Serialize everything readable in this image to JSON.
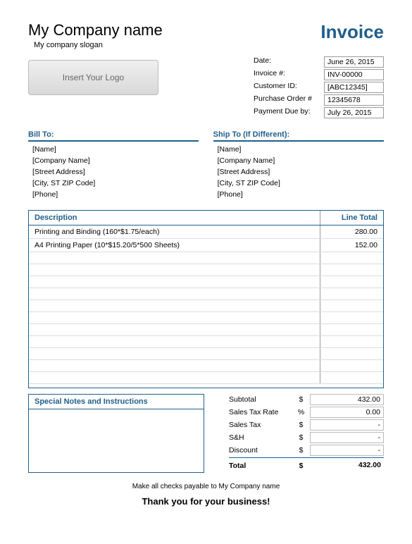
{
  "company": {
    "name": "My Company name",
    "slogan": "My company slogan"
  },
  "title": "Invoice",
  "logo_placeholder": "Insert Your Logo",
  "meta": {
    "date_label": "Date:",
    "date": "June 26, 2015",
    "inv_label": "Invoice #:",
    "inv": "INV-00000",
    "cust_label": "Customer ID:",
    "cust": "[ABC12345]",
    "po_label": "Purchase Order #",
    "po": "12345678",
    "due_label": "Payment Due by:",
    "due": "July 26, 2015"
  },
  "bill": {
    "title": "Bill To:",
    "name": "[Name]",
    "company": "[Company Name]",
    "street": "[Street Address]",
    "city": "[City, ST ZIP Code]",
    "phone": "[Phone]"
  },
  "ship": {
    "title": "Ship To (If Different):",
    "name": "[Name]",
    "company": "[Company Name]",
    "street": "[Street Address]",
    "city": "[City, ST ZIP Code]",
    "phone": "[Phone]"
  },
  "items": {
    "desc_header": "Description",
    "total_header": "Line Total",
    "rows": [
      {
        "desc": "Printing and Binding (160*$1.75/each)",
        "total": "280.00"
      },
      {
        "desc": "A4 Printing Paper (10*$15.20/5*500 Sheets)",
        "total": "152.00"
      }
    ]
  },
  "notes_title": "Special Notes and Instructions",
  "totals": {
    "subtotal_label": "Subtotal",
    "subtotal": "432.00",
    "taxrate_label": "Sales Tax Rate",
    "taxrate": "0.00",
    "tax_label": "Sales Tax",
    "tax": "-",
    "sh_label": "S&H",
    "sh": "-",
    "disc_label": "Discount",
    "disc": "-",
    "total_label": "Total",
    "total": "432.00",
    "dollar": "$",
    "percent": "%"
  },
  "payable": "Make all checks payable to My Company name",
  "thanks": "Thank you for your business!"
}
